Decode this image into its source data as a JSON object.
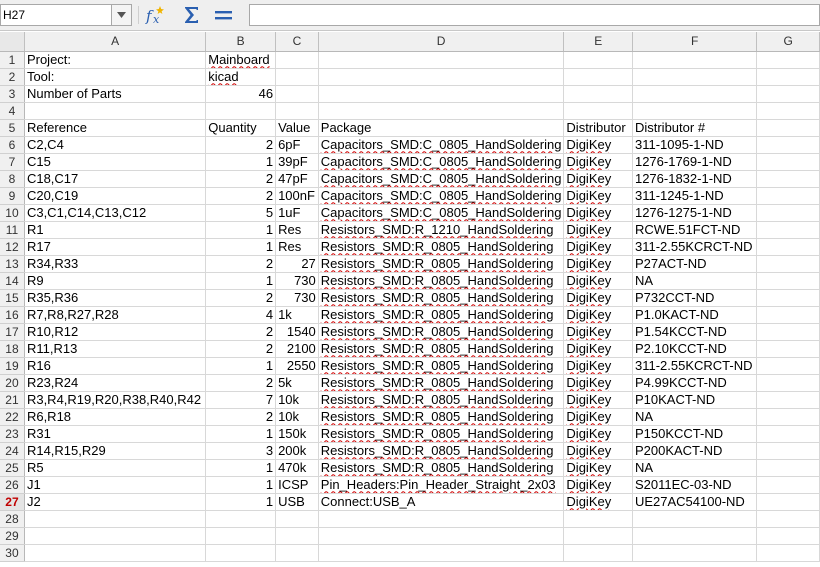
{
  "formula_bar": {
    "cell_ref": "H27",
    "formula": ""
  },
  "columns": [
    "A",
    "B",
    "C",
    "D",
    "E",
    "F",
    "G"
  ],
  "rows": [
    {
      "n": "1",
      "a": "Project:",
      "b": "Mainboard",
      "c": "",
      "d": "",
      "e": "",
      "f": ""
    },
    {
      "n": "2",
      "a": "Tool:",
      "b": "kicad",
      "c": "",
      "d": "",
      "e": "",
      "f": ""
    },
    {
      "n": "3",
      "a": "Number of Parts",
      "b": "46",
      "c": "",
      "d": "",
      "e": "",
      "f": ""
    },
    {
      "n": "4",
      "a": "",
      "b": "",
      "c": "",
      "d": "",
      "e": "",
      "f": ""
    },
    {
      "n": "5",
      "a": "Reference",
      "b": "Quantity",
      "c": "Value",
      "d": "Package",
      "e": "Distributor",
      "f": "Distributor #"
    },
    {
      "n": "6",
      "a": "C2,C4",
      "b": "2",
      "c": "6pF",
      "d": "Capacitors_SMD:C_0805_HandSoldering",
      "e": "DigiKey",
      "f": "311-1095-1-ND"
    },
    {
      "n": "7",
      "a": "C15",
      "b": "1",
      "c": "39pF",
      "d": "Capacitors_SMD:C_0805_HandSoldering",
      "e": "DigiKey",
      "f": "1276-1769-1-ND"
    },
    {
      "n": "8",
      "a": "C18,C17",
      "b": "2",
      "c": "47pF",
      "d": "Capacitors_SMD:C_0805_HandSoldering",
      "e": "DigiKey",
      "f": "1276-1832-1-ND"
    },
    {
      "n": "9",
      "a": "C20,C19",
      "b": "2",
      "c": "100nF",
      "d": "Capacitors_SMD:C_0805_HandSoldering",
      "e": "DigiKey",
      "f": "311-1245-1-ND"
    },
    {
      "n": "10",
      "a": "C3,C1,C14,C13,C12",
      "b": "5",
      "c": "1uF",
      "d": "Capacitors_SMD:C_0805_HandSoldering",
      "e": "DigiKey",
      "f": "1276-1275-1-ND"
    },
    {
      "n": "11",
      "a": "R1",
      "b": "1",
      "c": "Res",
      "d": "Resistors_SMD:R_1210_HandSoldering",
      "e": "DigiKey",
      "f": "RCWE.51FCT-ND"
    },
    {
      "n": "12",
      "a": "R17",
      "b": "1",
      "c": "Res",
      "d": "Resistors_SMD:R_0805_HandSoldering",
      "e": "DigiKey",
      "f": "311-2.55KCRCT-ND"
    },
    {
      "n": "13",
      "a": "R34,R33",
      "b": "2",
      "c": "27",
      "d": "Resistors_SMD:R_0805_HandSoldering",
      "e": "DigiKey",
      "f": "P27ACT-ND"
    },
    {
      "n": "14",
      "a": "R9",
      "b": "1",
      "c": "730",
      "d": "Resistors_SMD:R_0805_HandSoldering",
      "e": "DigiKey",
      "f": "NA"
    },
    {
      "n": "15",
      "a": "R35,R36",
      "b": "2",
      "c": "730",
      "d": "Resistors_SMD:R_0805_HandSoldering",
      "e": "DigiKey",
      "f": "P732CCT-ND"
    },
    {
      "n": "16",
      "a": "R7,R8,R27,R28",
      "b": "4",
      "c": "1k",
      "d": "Resistors_SMD:R_0805_HandSoldering",
      "e": "DigiKey",
      "f": "P1.0KACT-ND"
    },
    {
      "n": "17",
      "a": "R10,R12",
      "b": "2",
      "c": "1540",
      "d": "Resistors_SMD:R_0805_HandSoldering",
      "e": "DigiKey",
      "f": "P1.54KCCT-ND"
    },
    {
      "n": "18",
      "a": "R11,R13",
      "b": "2",
      "c": "2100",
      "d": "Resistors_SMD:R_0805_HandSoldering",
      "e": "DigiKey",
      "f": "P2.10KCCT-ND"
    },
    {
      "n": "19",
      "a": "R16",
      "b": "1",
      "c": "2550",
      "d": "Resistors_SMD:R_0805_HandSoldering",
      "e": "DigiKey",
      "f": "311-2.55KCRCT-ND"
    },
    {
      "n": "20",
      "a": "R23,R24",
      "b": "2",
      "c": "5k",
      "d": "Resistors_SMD:R_0805_HandSoldering",
      "e": "DigiKey",
      "f": "P4.99KCCT-ND"
    },
    {
      "n": "21",
      "a": "R3,R4,R19,R20,R38,R40,R42",
      "b": "7",
      "c": "10k",
      "d": "Resistors_SMD:R_0805_HandSoldering",
      "e": "DigiKey",
      "f": "P10KACT-ND"
    },
    {
      "n": "22",
      "a": "R6,R18",
      "b": "2",
      "c": "10k",
      "d": "Resistors_SMD:R_0805_HandSoldering",
      "e": "DigiKey",
      "f": "NA"
    },
    {
      "n": "23",
      "a": "R31",
      "b": "1",
      "c": "150k",
      "d": "Resistors_SMD:R_0805_HandSoldering",
      "e": "DigiKey",
      "f": "P150KCCT-ND"
    },
    {
      "n": "24",
      "a": "R14,R15,R29",
      "b": "3",
      "c": "200k",
      "d": "Resistors_SMD:R_0805_HandSoldering",
      "e": "DigiKey",
      "f": "P200KACT-ND"
    },
    {
      "n": "25",
      "a": "R5",
      "b": "1",
      "c": "470k",
      "d": "Resistors_SMD:R_0805_HandSoldering",
      "e": "DigiKey",
      "f": "NA"
    },
    {
      "n": "26",
      "a": "J1",
      "b": "1",
      "c": "ICSP",
      "d": "Pin_Headers:Pin_Header_Straight_2x03",
      "e": "DigiKey",
      "f": "S2011EC-03-ND"
    },
    {
      "n": "27",
      "a": "J2",
      "b": "1",
      "c": "USB",
      "d": "Connect:USB_A",
      "e": "DigiKey",
      "f": "UE27AC54100-ND"
    },
    {
      "n": "28",
      "a": "",
      "b": "",
      "c": "",
      "d": "",
      "e": "",
      "f": ""
    },
    {
      "n": "29",
      "a": "",
      "b": "",
      "c": "",
      "d": "",
      "e": "",
      "f": ""
    },
    {
      "n": "30",
      "a": "",
      "b": "",
      "c": "",
      "d": "",
      "e": "",
      "f": ""
    }
  ],
  "active_row": "27"
}
